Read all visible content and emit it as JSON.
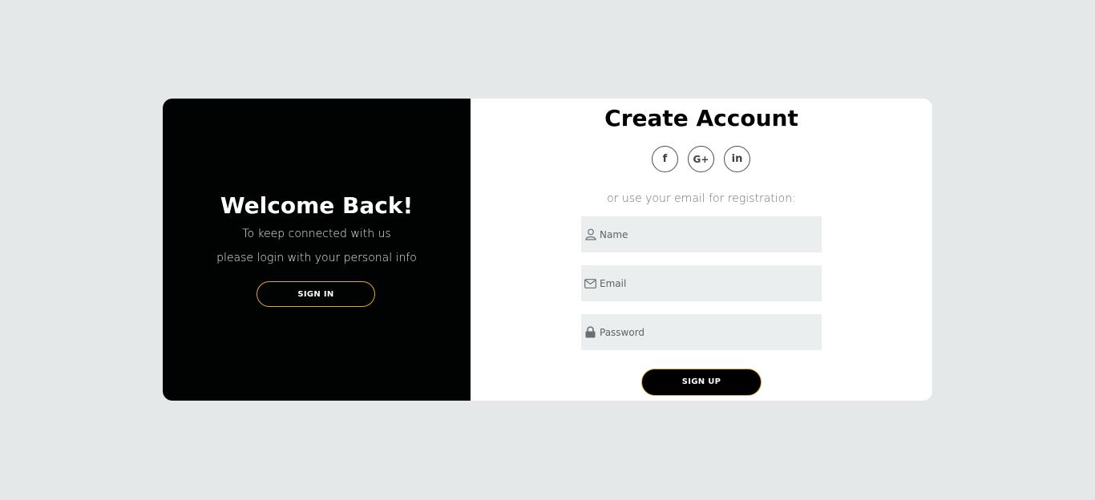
{
  "left_panel": {
    "title": "Welcome Back!",
    "line1": "To keep connected with us",
    "line2": "please login with your personal info",
    "signin_label": "SIGN IN"
  },
  "right_panel": {
    "title": "Create Account",
    "social": [
      {
        "icon": "facebook-icon",
        "glyph": "f"
      },
      {
        "icon": "google-plus-icon",
        "glyph": "G+"
      },
      {
        "icon": "linkedin-icon",
        "glyph": "in"
      }
    ],
    "hint": "or use your email for registration:",
    "fields": {
      "name_placeholder": "Name",
      "email_placeholder": "Email",
      "password_placeholder": "Password"
    },
    "signup_label": "SIGN UP"
  },
  "colors": {
    "background": "#e4e8e9",
    "left_panel": "#010302",
    "accent_border": "#e0a929",
    "field_bg": "#ebeeee"
  }
}
